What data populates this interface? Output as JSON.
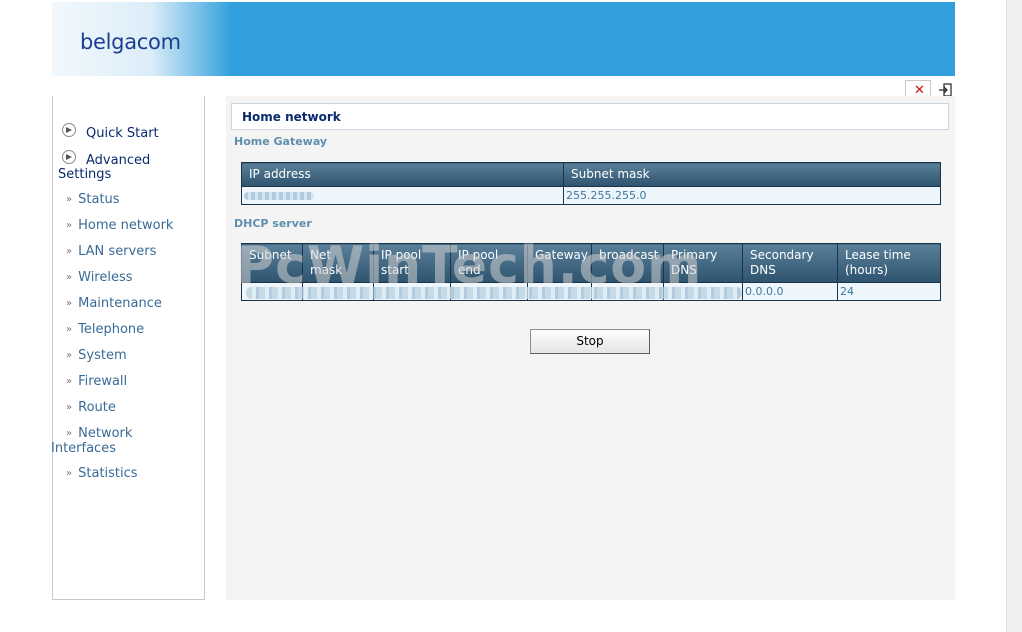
{
  "header": {
    "logo_text": "belgacom",
    "banner_color": "#31a0dc"
  },
  "toolbar": {
    "close_icon": "close-icon",
    "exit_icon": "exit-icon"
  },
  "sidebar": {
    "main_items": [
      {
        "label": "Quick Start"
      },
      {
        "label": "Advanced",
        "label2": "Settings"
      }
    ],
    "sub_items": [
      {
        "label": "Status"
      },
      {
        "label": "Home network"
      },
      {
        "label": "LAN servers"
      },
      {
        "label": "Wireless"
      },
      {
        "label": "Maintenance"
      },
      {
        "label": "Telephone"
      },
      {
        "label": "System"
      },
      {
        "label": "Firewall"
      },
      {
        "label": "Route"
      },
      {
        "label": "Network",
        "label2": "Interfaces"
      },
      {
        "label": "Statistics"
      }
    ]
  },
  "main": {
    "title": "Home network",
    "gateway": {
      "section_label": "Home Gateway",
      "columns": [
        "IP address",
        "Subnet mask"
      ],
      "row": {
        "ip": "",
        "subnet_mask": "255.255.255.0"
      }
    },
    "dhcp": {
      "section_label": "DHCP server",
      "columns": [
        {
          "l1": "Subnet",
          "l2": ""
        },
        {
          "l1": "Net mask",
          "l2": ""
        },
        {
          "l1": "IP pool",
          "l2": "start"
        },
        {
          "l1": "IP pool",
          "l2": "end"
        },
        {
          "l1": "Gateway",
          "l2": ""
        },
        {
          "l1": "broadcast",
          "l2": ""
        },
        {
          "l1": "Primary",
          "l2": "DNS"
        },
        {
          "l1": "Secondary",
          "l2": "DNS"
        },
        {
          "l1": "Lease time",
          "l2": "(hours)"
        }
      ],
      "row": {
        "secondary_dns": "0.0.0.0",
        "lease_time": "24"
      }
    },
    "stop_button": "Stop"
  },
  "watermark": "PcWinTech.com"
}
